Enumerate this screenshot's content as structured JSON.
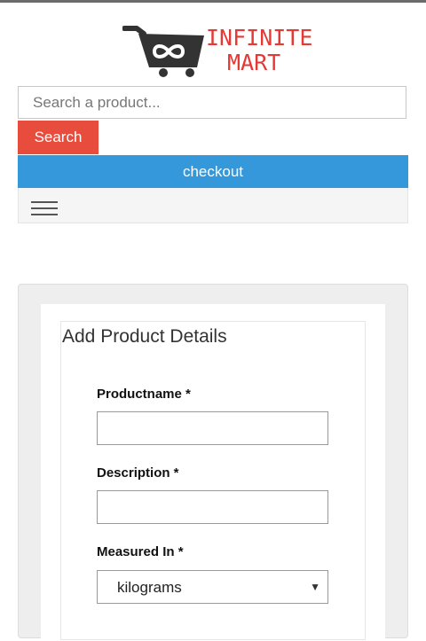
{
  "brand": {
    "line1": "INFINITE",
    "line2": "MART",
    "color": "#e53935"
  },
  "search": {
    "placeholder": "Search a product...",
    "value": "",
    "button_label": "Search"
  },
  "checkout": {
    "label": "checkout"
  },
  "navbar": {
    "menu_icon": "hamburger-icon"
  },
  "form": {
    "title": "Add Product Details",
    "fields": {
      "productname": {
        "label": "Productname *",
        "value": ""
      },
      "description": {
        "label": "Description *",
        "value": ""
      },
      "measured_in": {
        "label": "Measured In *",
        "selected": "kilograms"
      }
    }
  },
  "colors": {
    "search_button": "#e74c3c",
    "checkout_bar": "#3498db"
  }
}
